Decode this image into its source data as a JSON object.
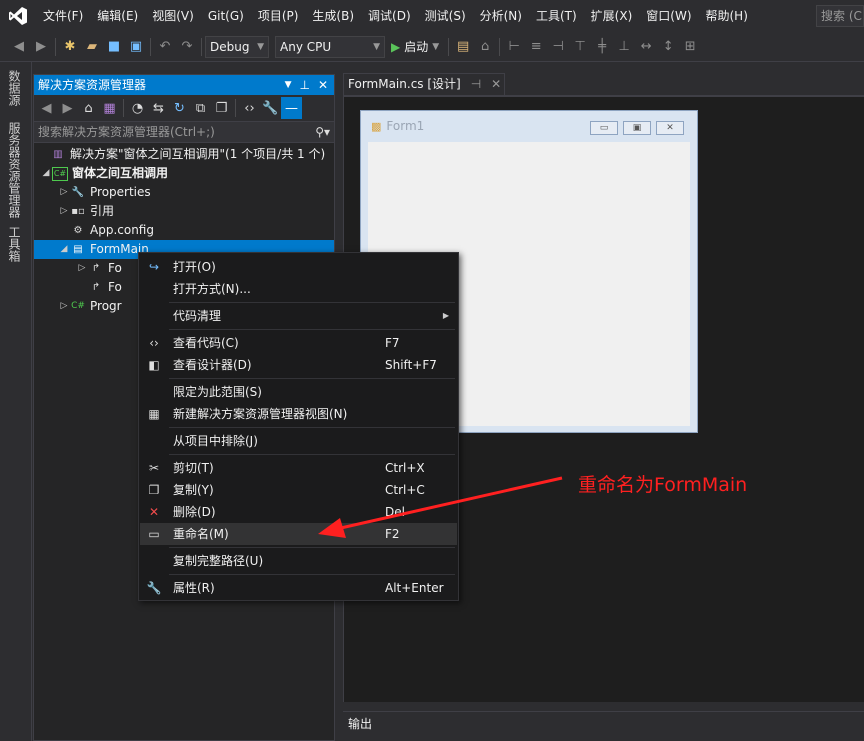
{
  "menubar": {
    "items": [
      "文件(F)",
      "编辑(E)",
      "视图(V)",
      "Git(G)",
      "项目(P)",
      "生成(B)",
      "调试(D)",
      "测试(S)",
      "分析(N)",
      "工具(T)",
      "扩展(X)",
      "窗口(W)",
      "帮助(H)"
    ],
    "search": "搜索 (C"
  },
  "toolbar": {
    "config": "Debug",
    "platform": "Any CPU",
    "start_label": "启动"
  },
  "left_strip": {
    "tabs": [
      "数据源",
      "服务器资源管理器",
      "工具箱"
    ]
  },
  "solution_explorer": {
    "title": "解决方案资源管理器",
    "search_placeholder": "搜索解决方案资源管理器(Ctrl+;)",
    "rows": [
      {
        "label": "解决方案\"窗体之间互相调用\"(1 个项目/共 1 个)",
        "icon": "solution-icon"
      },
      {
        "label": "窗体之间互相调用",
        "icon": "csharp-project-icon"
      },
      {
        "label": "Properties",
        "icon": "wrench-icon"
      },
      {
        "label": "引用",
        "icon": "references-icon"
      },
      {
        "label": "App.config",
        "icon": "config-icon"
      },
      {
        "label": "FormMain",
        "icon": "form-icon"
      },
      {
        "label": "Fo",
        "icon": "file-icon"
      },
      {
        "label": "Fo",
        "icon": "file-icon"
      },
      {
        "label": "Progr",
        "icon": "csharp-file-icon"
      }
    ]
  },
  "document": {
    "tab_label": "FormMain.cs [设计]",
    "form_title": "Form1"
  },
  "output": {
    "title": "输出"
  },
  "context_menu": {
    "items": [
      {
        "label": "打开(O)",
        "shortcut": "",
        "icon": "open-icon"
      },
      {
        "label": "打开方式(N)...",
        "shortcut": "",
        "icon": ""
      },
      {
        "label": "代码清理",
        "shortcut": "",
        "icon": ""
      },
      {
        "label": "查看代码(C)",
        "shortcut": "F7",
        "icon": "code-icon"
      },
      {
        "label": "查看设计器(D)",
        "shortcut": "Shift+F7",
        "icon": "designer-icon"
      },
      {
        "label": "限定为此范围(S)",
        "shortcut": "",
        "icon": ""
      },
      {
        "label": "新建解决方案资源管理器视图(N)",
        "shortcut": "",
        "icon": "new-view-icon"
      },
      {
        "label": "从项目中排除(J)",
        "shortcut": "",
        "icon": ""
      },
      {
        "label": "剪切(T)",
        "shortcut": "Ctrl+X",
        "icon": "cut-icon"
      },
      {
        "label": "复制(Y)",
        "shortcut": "Ctrl+C",
        "icon": "copy-icon"
      },
      {
        "label": "删除(D)",
        "shortcut": "Del",
        "icon": "delete-icon"
      },
      {
        "label": "重命名(M)",
        "shortcut": "F2",
        "icon": "rename-icon"
      },
      {
        "label": "复制完整路径(U)",
        "shortcut": "",
        "icon": ""
      },
      {
        "label": "属性(R)",
        "shortcut": "Alt+Enter",
        "icon": "wrench-icon"
      }
    ]
  },
  "annotation": {
    "text": "重命名为FormMain",
    "color": "#ff2020"
  },
  "colors": {
    "accent": "#007acc",
    "background": "#2d2d30",
    "panel": "#252526"
  }
}
